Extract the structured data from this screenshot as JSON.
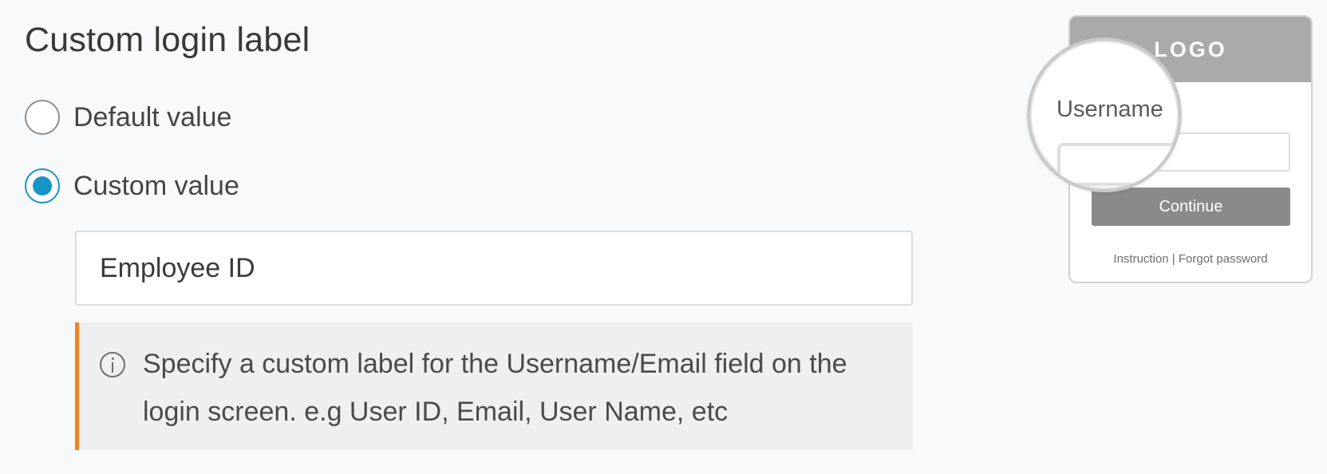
{
  "section": {
    "title": "Custom login label"
  },
  "options": {
    "default_label": "Default value",
    "custom_label": "Custom value",
    "selected": "custom"
  },
  "custom_input": {
    "value": "Employee ID"
  },
  "info": {
    "text": "Specify a custom label for the Username/Email field on the login screen. e.g User ID, Email, User Name, etc",
    "icon": "info-circle-icon",
    "accent_color": "#f5821f"
  },
  "preview": {
    "logo": "LOGO",
    "magnified_label": "Username",
    "button_label": "Continue",
    "instruction_link": "Instruction",
    "separator": " | ",
    "forgot_link": "Forgot password"
  },
  "colors": {
    "radio_selected": "#1595c5",
    "preview_header": "#a9aaa9",
    "preview_button": "#8a8a8a"
  }
}
